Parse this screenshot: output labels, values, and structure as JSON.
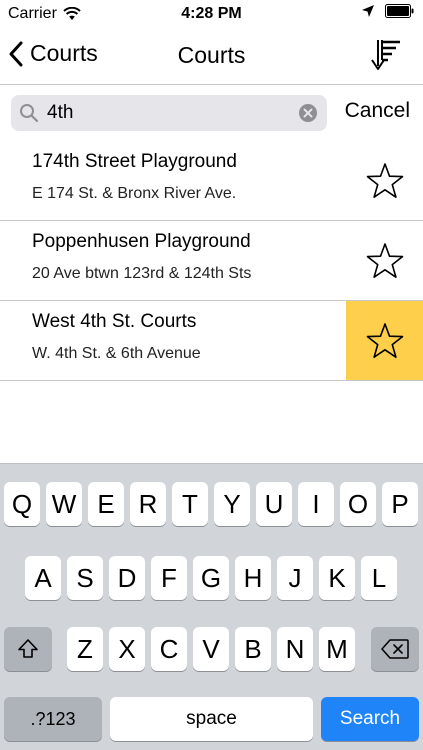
{
  "status_bar": {
    "carrier": "Carrier",
    "time": "4:28 PM"
  },
  "nav": {
    "back_label": "Courts",
    "title": "Courts"
  },
  "search": {
    "value": "4th",
    "cancel_label": "Cancel"
  },
  "results": [
    {
      "name": "174th Street Playground",
      "address": "E 174 St. & Bronx River Ave.",
      "favorite": false
    },
    {
      "name": "Poppenhusen Playground",
      "address": "20 Ave btwn 123rd & 124th Sts",
      "favorite": false
    },
    {
      "name": "West 4th St. Courts",
      "address": "W. 4th St. & 6th Avenue",
      "favorite": true
    }
  ],
  "keyboard": {
    "row1": [
      "Q",
      "W",
      "E",
      "R",
      "T",
      "Y",
      "U",
      "I",
      "O",
      "P"
    ],
    "row2": [
      "A",
      "S",
      "D",
      "F",
      "G",
      "H",
      "J",
      "K",
      "L"
    ],
    "row3": [
      "Z",
      "X",
      "C",
      "V",
      "B",
      "N",
      "M"
    ],
    "numbers_label": ".?123",
    "space_label": "space",
    "search_label": "Search"
  },
  "colors": {
    "favorite_highlight": "#fecf4a",
    "search_key": "#1e84f8",
    "keyboard_bg": "#d1d4d9"
  },
  "icons": {
    "wifi": "wifi-icon",
    "location": "location-arrow-icon",
    "battery": "battery-icon",
    "back": "chevron-left-icon",
    "sort": "sort-icon",
    "search": "search-icon",
    "clear": "clear-icon",
    "star": "star-icon",
    "shift": "shift-icon",
    "delete": "delete-icon"
  }
}
